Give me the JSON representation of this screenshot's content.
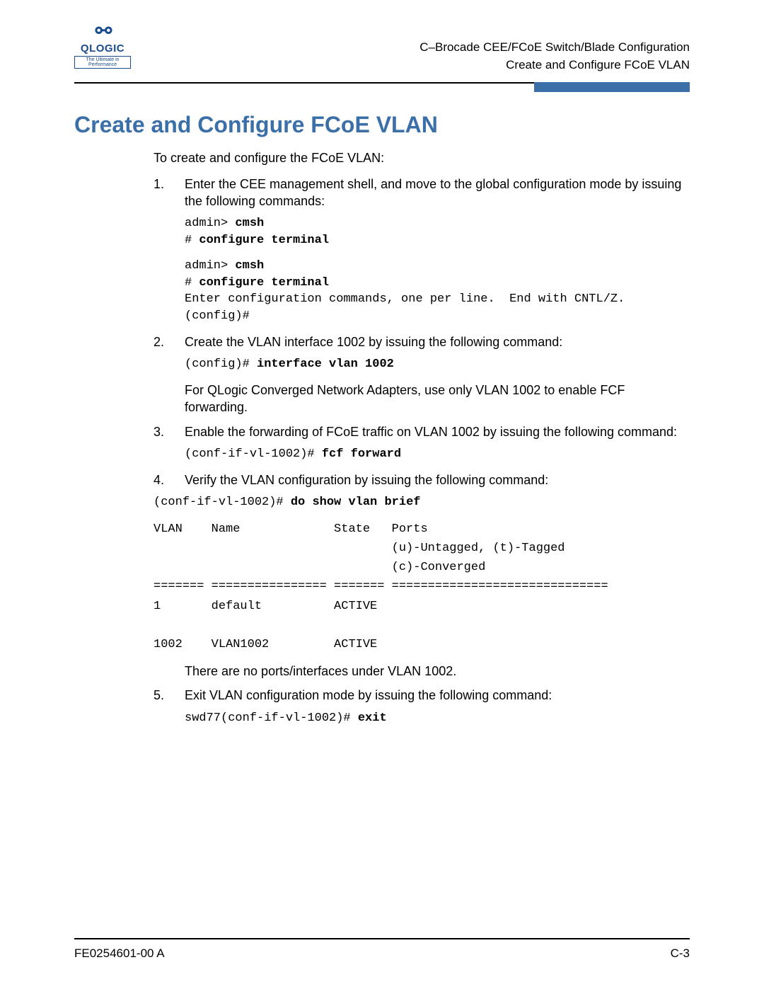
{
  "logo": {
    "brand": "QLOGIC",
    "tagline": "The Ultimate in Performance"
  },
  "header": {
    "line1": "C–Brocade CEE/FCoE Switch/Blade Configuration",
    "line2": "Create and Configure FCoE VLAN"
  },
  "title": "Create and Configure FCoE VLAN",
  "intro": "To create and configure the FCoE VLAN:",
  "steps": {
    "s1": {
      "text": "Enter the CEE management shell, and move to the global configuration mode by issuing the following commands:",
      "code1_line1_a": "admin> ",
      "code1_line1_b": "cmsh",
      "code1_line2_a": "# ",
      "code1_line2_b": "configure terminal",
      "code2_line1_a": "admin> ",
      "code2_line1_b": "cmsh",
      "code2_line2_a": "# ",
      "code2_line2_b": "configure terminal",
      "code2_line3": "Enter configuration commands, one per line.  End with CNTL/Z.",
      "code2_line4": "(config)#"
    },
    "s2": {
      "text": "Create the VLAN interface 1002 by issuing the following command:",
      "code_a": "(config)# ",
      "code_b": "interface vlan 1002",
      "note": "For QLogic Converged Network Adapters, use only VLAN 1002 to enable FCF forwarding."
    },
    "s3": {
      "text": "Enable the forwarding of FCoE traffic on VLAN 1002 by issuing the following command:",
      "code_a": "(conf-if-vl-1002)# ",
      "code_b": "fcf forward"
    },
    "s4": {
      "text": "Verify the VLAN configuration by issuing the following command:",
      "code_a": "(conf-if-vl-1002)# ",
      "code_b": "do show vlan brief",
      "output": "VLAN    Name             State   Ports\n                                 (u)-Untagged, (t)-Tagged\n                                 (c)-Converged\n======= ================ ======= ==============================\n1       default          ACTIVE\n\n1002    VLAN1002         ACTIVE",
      "note": "There are no ports/interfaces under VLAN 1002."
    },
    "s5": {
      "text": "Exit VLAN configuration mode by issuing the following command:",
      "code_a": "swd77(conf-if-vl-1002)# ",
      "code_b": "exit"
    }
  },
  "footer": {
    "left": "FE0254601-00 A",
    "right": "C-3"
  }
}
